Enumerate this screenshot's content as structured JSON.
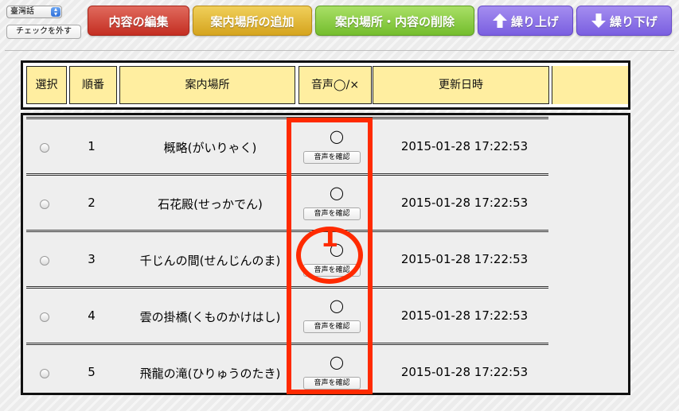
{
  "toolbar": {
    "language_selected": "臺灣話",
    "uncheck_label": "チェックを外す",
    "edit_label": "内容の編集",
    "add_label": "案内場所の追加",
    "delete_label": "案内場所・内容の削除",
    "move_up_label": "繰り上げ",
    "move_down_label": "繰り下げ",
    "colors": {
      "edit": "#c42e22",
      "add": "#d5a41e",
      "delete": "#74bd2d",
      "move": "#7a5fe0"
    }
  },
  "table": {
    "headers": {
      "select": "選択",
      "order": "順番",
      "place": "案内場所",
      "audio": "音声◯/×",
      "updated": "更新日時"
    },
    "rows": [
      {
        "order": "1",
        "place": "概略(がいりゃく)",
        "audio": "◯",
        "check": "音声を確認",
        "updated": "2015-01-28 17:22:53"
      },
      {
        "order": "2",
        "place": "石花殿(せっかでん)",
        "audio": "◯",
        "check": "音声を確認",
        "updated": "2015-01-28 17:22:53"
      },
      {
        "order": "3",
        "place": "千じんの間(せんじんのま)",
        "audio": "◯",
        "check": "音声を確認",
        "updated": "2015-01-28 17:22:53"
      },
      {
        "order": "4",
        "place": "雲の掛橋(くものかけはし)",
        "audio": "◯",
        "check": "音声を確認",
        "updated": "2015-01-28 17:22:53"
      },
      {
        "order": "5",
        "place": "飛龍の滝(ひりゅうのたき)",
        "audio": "◯",
        "check": "音声を確認",
        "updated": "2015-01-28 17:22:53"
      }
    ],
    "header_color": "#ffeea0"
  },
  "annotation": {
    "number": "1",
    "color": "#ff2a00"
  }
}
